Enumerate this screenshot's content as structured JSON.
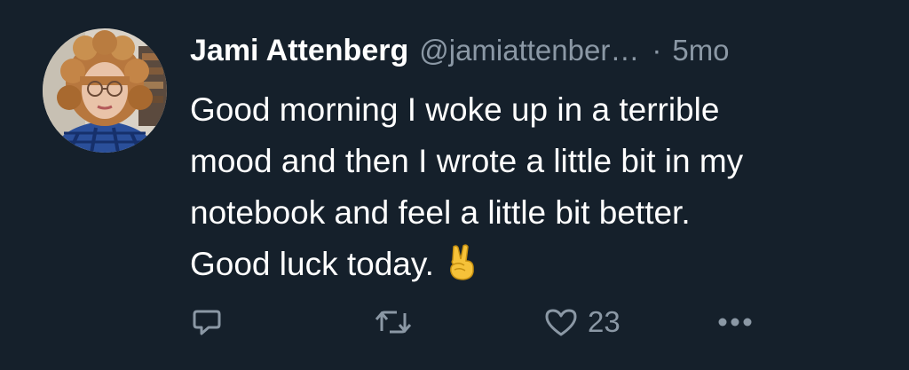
{
  "tweet": {
    "author_name": "Jami Attenberg",
    "author_handle": "@jamiattenber…",
    "separator": "·",
    "timestamp": "5mo",
    "text_lines": [
      "Good morning I woke up in a terrible",
      "mood and then I wrote a little bit in my",
      "notebook and feel a little bit better.",
      "Good luck today."
    ],
    "emoji": "victory-hand-emoji",
    "avatar": "profile-photo"
  },
  "actions": {
    "reply": {
      "icon": "reply-icon"
    },
    "retweet": {
      "icon": "retweet-icon"
    },
    "like": {
      "icon": "heart-icon",
      "count": "23"
    },
    "more": {
      "icon": "more-icon"
    }
  },
  "colors": {
    "background": "#15202b",
    "primary_text": "#ffffff",
    "secondary_text": "#8b98a5",
    "emoji_yellow": "#f6c239"
  }
}
